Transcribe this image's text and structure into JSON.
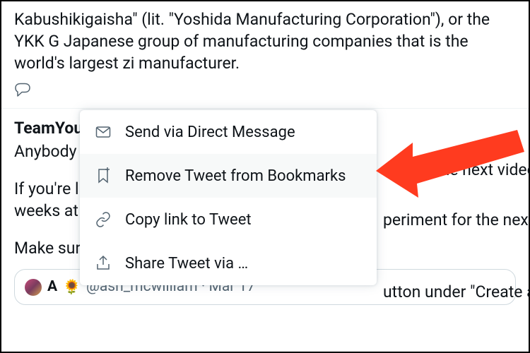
{
  "tweet1": {
    "text": "Kabushikigaisha\" (lit. \"Yoshida Manufacturing Corporation\"), or the YKK G Japanese group of manufacturing companies that is the world's largest zi manufacturer."
  },
  "tweet2": {
    "author": "TeamYou",
    "line1_left": "Anybody",
    "line1_right": "eue up the next video?",
    "line2_left": "If you're li",
    "line2_right": "periment for the next tw",
    "line3_left": "weeks at",
    "line4_left": "Make sure",
    "line4_right": "utton under \"Create a Q"
  },
  "quote": {
    "name": "A",
    "emoji": "🌻",
    "handle": "@ash_mcwilliam",
    "date": "Mar 17"
  },
  "menu": {
    "items": [
      {
        "label": "Send via Direct Message",
        "icon": "envelope-icon"
      },
      {
        "label": "Remove Tweet from Bookmarks",
        "icon": "bookmark-remove-icon"
      },
      {
        "label": "Copy link to Tweet",
        "icon": "link-icon"
      },
      {
        "label": "Share Tweet via …",
        "icon": "share-icon"
      }
    ]
  },
  "colors": {
    "arrow": "#ff3b1f"
  }
}
